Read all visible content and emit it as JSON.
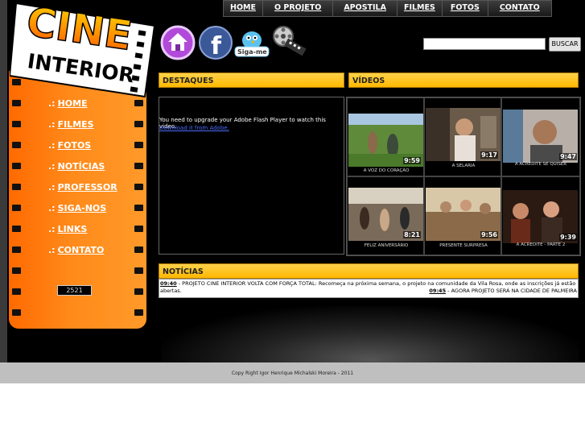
{
  "topnav": {
    "items": [
      "HOME",
      "O PROJETO",
      "APOSTILA",
      "FILMES",
      "FOTOS",
      "CONTATO"
    ]
  },
  "logo": {
    "line1": "CINE",
    "line2": "INTERIOR"
  },
  "sidebar": {
    "prefix": ".:",
    "items": [
      "HOME",
      "FILMES",
      "FOTOS",
      "NOTÍCIAS",
      "PROFESSOR",
      "SIGA-NOS",
      "LINKS",
      "CONTATO"
    ],
    "counter": "2521"
  },
  "social": {
    "icons": [
      "home-icon",
      "facebook-icon",
      "twitter-bird-icon",
      "film-reel-icon"
    ],
    "twitter_label": "Siga-me"
  },
  "search": {
    "button_label": "BUSCAR",
    "value": ""
  },
  "destaques": {
    "title": "DESTAQUES",
    "flash_message": "You need to upgrade your Adobe Flash Player to watch this video.",
    "flash_link": "Download it from Adobe."
  },
  "videos": {
    "title": "VÍDEOS",
    "items": [
      {
        "caption": "A VOZ DO CORAÇÃO",
        "duration": "9:59"
      },
      {
        "caption": "A SELARIA",
        "duration": "9:17"
      },
      {
        "caption": "A ACREDITE SE QUISER",
        "duration": "9:47"
      },
      {
        "caption": "FELIZ ANIVERSÁRIO",
        "duration": "8:21"
      },
      {
        "caption": "PRESENTE SURPRESA",
        "duration": "9:56"
      },
      {
        "caption": "A ACREDITE - PARTE 2",
        "duration": "9:39"
      }
    ]
  },
  "noticias": {
    "title": "NOTÍCIAS",
    "items": [
      {
        "time": "09:40",
        "text": " - PROJETO CINE INTERIOR VOLTA COM FORÇA TOTAL: Recomeça na próxima semana, o projeto na comunidade da Vila Rosa, onde as inscrições já estão abertas."
      },
      {
        "time": "09:45",
        "text": " - AGORA PROJETO SERÁ NA CIDADE DE PALMEIRA"
      }
    ]
  },
  "footer": {
    "text": "Copy Right Igor Henrique Michalski Moreira - 2011"
  },
  "colors": {
    "orange": "#ff7a00",
    "yellow_bar": "#ffc21a",
    "background": "#000000"
  }
}
